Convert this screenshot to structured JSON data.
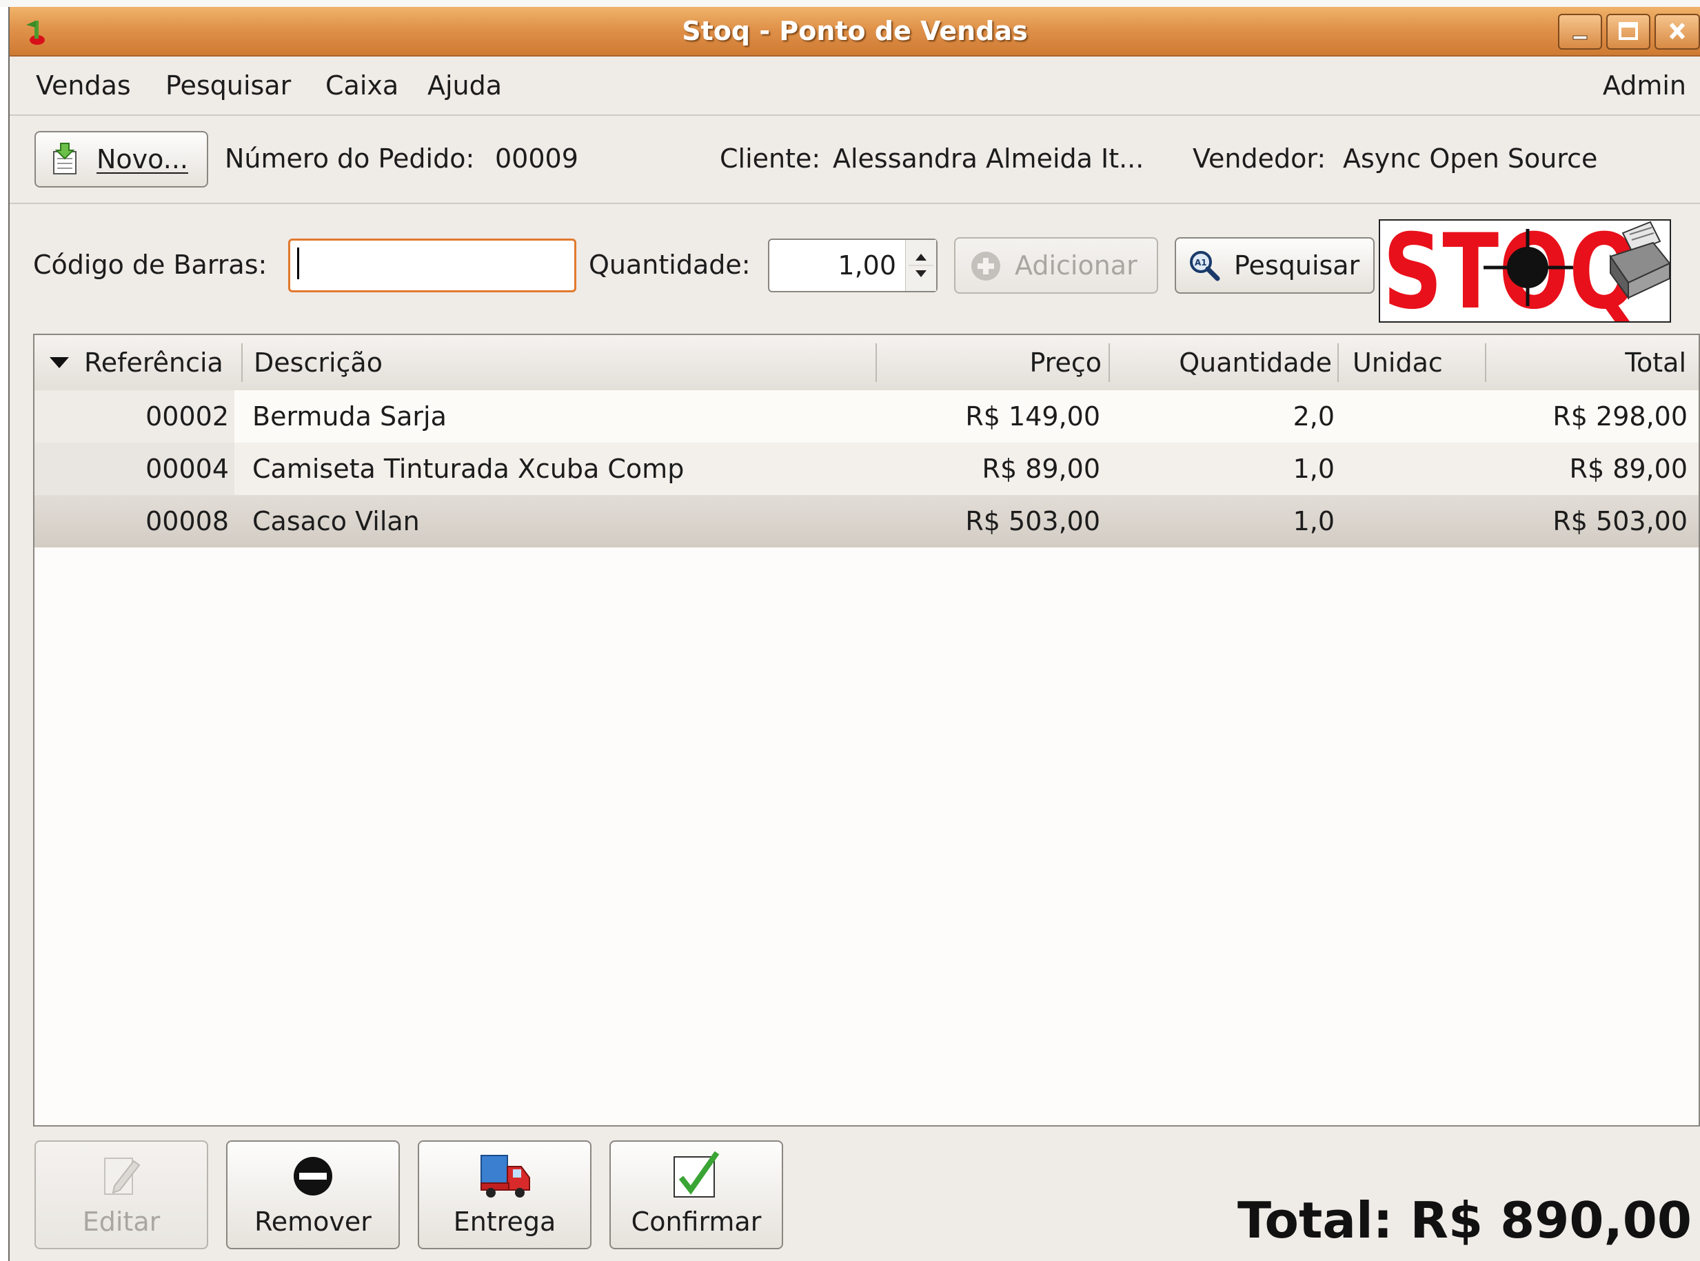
{
  "window": {
    "title": "Stoq - Ponto de Vendas"
  },
  "menubar": {
    "items": [
      {
        "label": "Vendas",
        "mnemonic": "e"
      },
      {
        "label": "Pesquisar",
        "mnemonic": "s"
      },
      {
        "label": "Caixa",
        "mnemonic": "C"
      },
      {
        "label": "Ajuda",
        "mnemonic": "A"
      }
    ],
    "user": "Admin"
  },
  "toolbar": {
    "new_label": "Novo...",
    "order_label": "Número do Pedido:",
    "order_number": "00009",
    "client_label": "Cliente:",
    "client_name": "Alessandra Almeida It...",
    "seller_label": "Vendedor:",
    "seller_name": "Async Open Source"
  },
  "entry_row": {
    "barcode_label": "Código de Barras:",
    "barcode_value": "",
    "quantity_label": "Quantidade:",
    "quantity_value": "1,00",
    "add_label": "Adicionar",
    "search_label": "Pesquisar",
    "logo_text": "STOQ"
  },
  "table": {
    "columns": [
      "Referência",
      "Descrição",
      "Preço",
      "Quantidade",
      "Unidac",
      "Total"
    ],
    "rows": [
      {
        "ref": "00002",
        "desc": "Bermuda Sarja",
        "price": "R$ 149,00",
        "qty": "2,0",
        "unit": "",
        "total": "R$ 298,00"
      },
      {
        "ref": "00004",
        "desc": "Camiseta Tinturada Xcuba Comp",
        "price": "R$ 89,00",
        "qty": "1,0",
        "unit": "",
        "total": "R$ 89,00"
      },
      {
        "ref": "00008",
        "desc": "Casaco Vilan",
        "price": "R$ 503,00",
        "qty": "1,0",
        "unit": "",
        "total": "R$ 503,00"
      }
    ],
    "selected_row": 2
  },
  "actions": {
    "edit_label": "Editar",
    "remove_label": "Remover",
    "delivery_label": "Entrega",
    "confirm_label": "Confirmar"
  },
  "summary": {
    "total_text": "Total: R$ 890,00"
  },
  "colors": {
    "titlebar": "#e0924a",
    "window_bg": "#efebe7",
    "entry_focus": "#e07a2e",
    "logo_red": "#e8101a"
  }
}
